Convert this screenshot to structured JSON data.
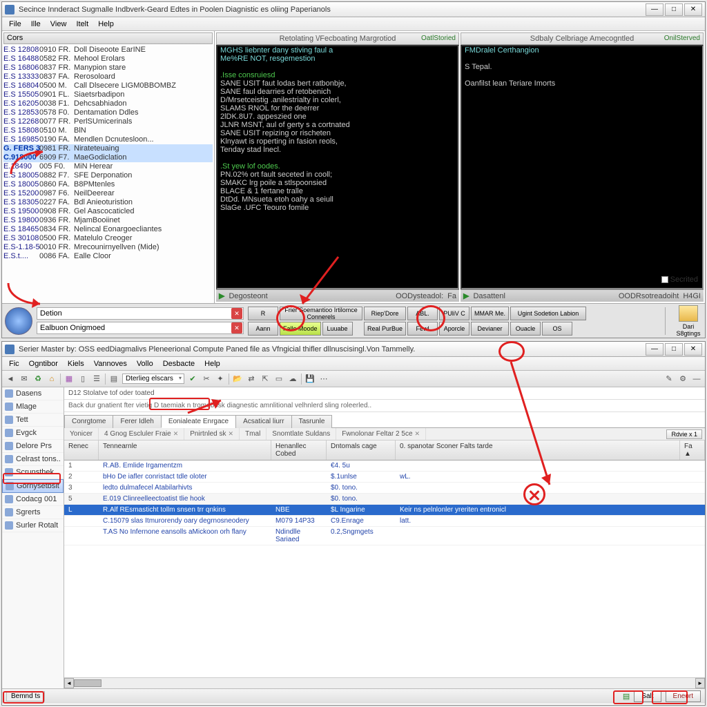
{
  "win1": {
    "title": "Secince Innderact Sugmalle Indbverk-Geard Edtes in Poolen Diagnistic es oliing Paperianols",
    "menus": [
      "File",
      "Ille",
      "View",
      "Itelt",
      "Help"
    ],
    "loghdr": "Cors",
    "logrows": [
      {
        "c1": "E.S 12808",
        "c2": "0910 FR.",
        "c3": "Doll Diseoote EarINE"
      },
      {
        "c1": "E.S 16488",
        "c2": "0582 FR.",
        "c3": "Mehool Erolars"
      },
      {
        "c1": "E.S 16806",
        "c2": "0837 FR.",
        "c3": "Manypion stare"
      },
      {
        "c1": "E.S 13333",
        "c2": "0837 FA.",
        "c3": "Rerosoloard"
      },
      {
        "c1": "E.S 16804",
        "c2": "0500 M.",
        "c3": "Call Dlsecere LIGM0BBOMBZ"
      },
      {
        "c1": "E.S 15505",
        "c2": "0901 FL.",
        "c3": "Siaetsrbadipon"
      },
      {
        "c1": "E.S 16205",
        "c2": "0038 F1.",
        "c3": "Dehcsabhiadon"
      },
      {
        "c1": "E.S 12853",
        "c2": "0578 F0.",
        "c3": "Dentamation Ddles"
      },
      {
        "c1": "E.S 12268",
        "c2": "0077 FR.",
        "c3": "PerlSUmicerinals"
      },
      {
        "c1": "E.S 15808",
        "c2": "0510 M.",
        "c3": "BlN"
      },
      {
        "c1": "E.S 16985",
        "c2": "0190 FA.",
        "c3": "Mendlen Dcnutesloon..."
      },
      {
        "c1": "G. FERS  3",
        "c2": "0981 FR.",
        "c3": "Nirateteuaing",
        "hl": true
      },
      {
        "c1": "C.918000",
        "c2": "6909 F7.",
        "c3": "MaeGodiclation",
        "hl": true
      },
      {
        "c1": "E.18490",
        "c2": "005 F0.",
        "c3": "MiN Herear"
      },
      {
        "c1": "E.S 18005",
        "c2": "0882 F7.",
        "c3": "SFE Derponation"
      },
      {
        "c1": "E.S 18005",
        "c2": "0860 FA.",
        "c3": "B8PMtenles"
      },
      {
        "c1": "E.S 15200",
        "c2": "0987 F6.",
        "c3": "NeilDeerear"
      },
      {
        "c1": "E.S 18305",
        "c2": "0227 FA.",
        "c3": "Bdl Anieoturistion"
      },
      {
        "c1": "E.S 19500",
        "c2": "0908 FR.",
        "c3": "Gel Aascocaticled"
      },
      {
        "c1": "E.S 19800",
        "c2": "0936 FR.",
        "c3": "MjamBooiinet"
      },
      {
        "c1": "E.S 18465",
        "c2": "0834 FR.",
        "c3": "Nelincal Eonargoecliantes"
      },
      {
        "c1": "E.S 30108",
        "c2": "0500 FR.",
        "c3": "Matelulo Creoger"
      },
      {
        "c1": "E.S-1.18-5",
        "c2": "0010 FR.",
        "c3": "Mrecounirnyellven (Mide)"
      },
      {
        "c1": "E.S.t....",
        "c2": "0086 FA.",
        "c3": "Ealle Cloor"
      }
    ],
    "term1": {
      "title": "Retolating \\/Fecboating Margrotiod",
      "corner": "OatlStoried",
      "lines": [
        {
          "t": "MGHS liebnter dany stiving faul a",
          "cls": "cy"
        },
        {
          "t": "Me%RE NOT, resgemestion",
          "cls": "cy"
        },
        {
          "t": " ",
          "cls": ""
        },
        {
          "t": ".Isse consruiesd",
          "cls": "gr"
        },
        {
          "t": "SANE USIT faut lodas bert ratbonbje,",
          "cls": ""
        },
        {
          "t": "SANE faul dearries of retobenich",
          "cls": ""
        },
        {
          "t": "D/Mrsetceistig .anilestrialty in colerl,",
          "cls": ""
        },
        {
          "t": "SLAMS RNOL for the deerrer",
          "cls": ""
        },
        {
          "t": "2lDK.8U7. appeszied one",
          "cls": ""
        },
        {
          "t": "JLNR MSNT, aul of gerty s a cortnated",
          "cls": ""
        },
        {
          "t": "SANE USIT repizing or rischeten",
          "cls": ""
        },
        {
          "t": "Klnyawt is roperting in fasion reols,",
          "cls": ""
        },
        {
          "t": "Tenday stad lnecl.",
          "cls": ""
        },
        {
          "t": " ",
          "cls": ""
        },
        {
          "t": ".St yew lof oodes.",
          "cls": "gr"
        },
        {
          "t": "PN.02% ort fault seceted in cooll;",
          "cls": ""
        },
        {
          "t": "SMAKC lrg poile a stlspoonsied",
          "cls": ""
        },
        {
          "t": "BLACE & 1 fertane tralle",
          "cls": ""
        },
        {
          "t": "DtDd. MNsueta etoh oahy a seiull",
          "cls": ""
        },
        {
          "t": "SlaGe .UFC Teouro fomile",
          "cls": ""
        }
      ],
      "status": {
        "play": "▶",
        "l1": "Degosteont",
        "mid": "OODysteadol:",
        "r": "Fa"
      }
    },
    "term2": {
      "title": "Sdbaly Celbriage Amecogntled",
      "corner": "OnilSterved",
      "lines": [
        {
          "t": "FMDralel Certhangion",
          "cls": "cy"
        },
        {
          "t": " ",
          "cls": ""
        },
        {
          "t": "S Tepal.",
          "cls": ""
        },
        {
          "t": " ",
          "cls": ""
        },
        {
          "t": "Oanfilst lean Teriare Imorts",
          "cls": ""
        }
      ],
      "status": {
        "play": "▶",
        "l1": "Dasattenl",
        "mid": "OODRsotreadoiht",
        "r": "H4GI"
      }
    },
    "search1": "Detion",
    "search2": "Ealbuon Onigmoed",
    "btns": {
      "col1t": "R",
      "col1b": "Aann",
      "col2t": "Frier Soemantioo Irtilomce Connerels",
      "col2b": "Falle Moode",
      "col2c": "Luuabe",
      "col3t": "Riep'Dore",
      "col3b": "Real PurBue",
      "col4t": "ABL.",
      "col4b": "Fewl",
      "col5t": "PUliV C",
      "col5b": "Aporcle",
      "col6t": "MMAR Me.",
      "col6b": "Devianer",
      "col7t": "Ugint Sodetion Labion",
      "col7b": "Ouacle",
      "col7c": "OS"
    },
    "right": {
      "label": "Dari S8gtings"
    },
    "secreted": "Secrited"
  },
  "win2": {
    "title": "Serier Master by: OSS eedDiagmalivs Pleneerional Compute Paned file as Vfngicial thifler dllnuscisingl.Von Tammelly.",
    "menus": [
      "Fic",
      "Ogntibor",
      "Kiels",
      "Vannoves",
      "Vollo",
      "Desbacte",
      "Help"
    ],
    "combo": "Dterlieg elscars",
    "side": [
      "Dasens",
      "Mlage",
      "Tett",
      "Evgck",
      "Delore Prs",
      "Celrast tons..",
      "Scrunsthek",
      "Gornysetbslt",
      "Codacg 001",
      "Sgrerts",
      "Surler Rotalt"
    ],
    "sideSel": 7,
    "crumb": "D12 Stolatve tof oder toated",
    "desc": "Back dur gnatient fter vietig D taemiak n tromebosk diagnestic amnlitional velhnlerd sling roleerled..",
    "tabs": [
      "Conrgtome",
      "Ferer Idleh",
      "Eonialeate Enrgace",
      "Acsatical liurr",
      "Tasrunle"
    ],
    "tabAct": 2,
    "subtabs": [
      {
        "t": "Yonicer",
        "x": false
      },
      {
        "t": "4 Gnog Escluler Fraie",
        "x": true
      },
      {
        "t": "Pnirtnled sk",
        "x": true
      },
      {
        "t": "Tmal",
        "x": false
      },
      {
        "t": "Snomtlate Suldans",
        "x": false
      },
      {
        "t": "Fwnolonar Feltar 2 5ce",
        "x": true
      }
    ],
    "rbtn": "Rdvie x 1",
    "gcols": [
      "Renec",
      "Tennearnle",
      "Henanllec Cobed",
      "Dntomals cage",
      "0. spanotar Sconer Falts tarde",
      "Fa ▲"
    ],
    "rows": [
      {
        "c0": "1",
        "c1": "R.AB. Emlide Irgamentzm",
        "c2": "",
        "c3": "€4. 5u",
        "c4": ""
      },
      {
        "c0": "2",
        "c1": "bHo De iafler conristact tdle oloter",
        "c2": "",
        "c3": "$.1unlse",
        "c4": "wL."
      },
      {
        "c0": "3",
        "c1": "ledto dulmafecel Atabilarhivts",
        "c2": "",
        "c3": "$0. tono.",
        "c4": ""
      },
      {
        "c0": "5",
        "c1": "E.019 Clinreelleectoatist tlie hook",
        "c2": "",
        "c3": "$0. tono.",
        "c4": "",
        "alt": true
      },
      {
        "c0": "L",
        "c1": "R.Alf REsmasticht tollm snsen trr qnkins",
        "c2": "NBE",
        "c3": "$L Ingarine",
        "c4": "Keir ns  pelnlonler yreriten entronicl",
        "sel": true
      },
      {
        "c0": "",
        "c1": "C.15079 slas Itmurorendy oary degrnosneodery",
        "c2": "M079 14P33",
        "c3": "C9.Enrage",
        "c4": "latt."
      },
      {
        "c0": "",
        "c1": "T.AS No Infernone eansolls aMickoon orh flany",
        "c2": "Ndindlle Sariaed",
        "c3": "0.2,Sngmgets",
        "c4": ""
      }
    ],
    "status": {
      "left": "Bemnd ts",
      "save": "Salt",
      "exit": "Eneort"
    }
  }
}
